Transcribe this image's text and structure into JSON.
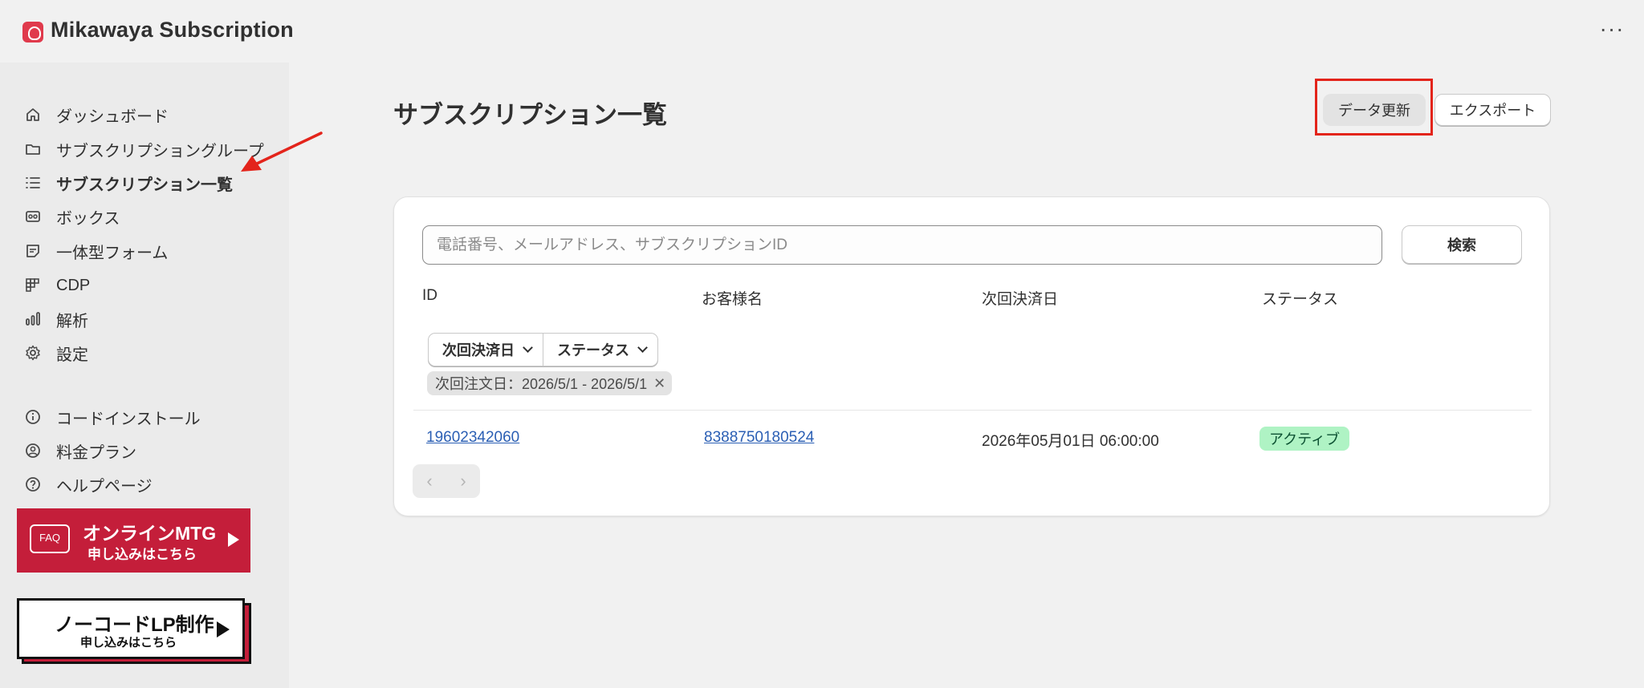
{
  "app": {
    "title": "Mikawaya Subscription",
    "more_label": "···"
  },
  "sidebar": {
    "items": [
      {
        "label": "ダッシュボード",
        "icon": "home-icon"
      },
      {
        "label": "サブスクリプショングループ",
        "icon": "folder-icon"
      },
      {
        "label": "サブスクリプション一覧",
        "icon": "list-icon",
        "active": true
      },
      {
        "label": "ボックス",
        "icon": "box-icon"
      },
      {
        "label": "一体型フォーム",
        "icon": "form-icon"
      },
      {
        "label": "CDP",
        "icon": "grid-icon"
      },
      {
        "label": "解析",
        "icon": "chart-icon"
      },
      {
        "label": "設定",
        "icon": "gear-icon"
      }
    ],
    "items2": [
      {
        "label": "コードインストール",
        "icon": "info-icon"
      },
      {
        "label": "料金プラン",
        "icon": "user-circle-icon"
      },
      {
        "label": "ヘルプページ",
        "icon": "help-icon"
      }
    ],
    "banner_mtg": {
      "faq": "FAQ",
      "title": "オンラインMTG",
      "sub": "申し込みはこちら"
    },
    "banner_lp": {
      "title": "ノーコードLP制作",
      "sub": "申し込みはこちら"
    }
  },
  "main": {
    "title": "サブスクリプション一覧",
    "refresh_label": "データ更新",
    "export_label": "エクスポート",
    "search": {
      "placeholder": "電話番号、メールアドレス、サブスクリプションID",
      "button": "検索"
    },
    "columns": [
      "ID",
      "お客様名",
      "次回決済日",
      "ステータス"
    ],
    "filters": [
      "次回決済日",
      "ステータス"
    ],
    "filter_tag": "次回注文日：2026/5/1 - 2026/5/1",
    "rows": [
      {
        "id": "19602342060",
        "customer": "8388750180524",
        "next_date": "2026年05月01日 06:00:00",
        "status": "アクティブ"
      }
    ]
  },
  "colors": {
    "accent_red": "#c41e3a",
    "highlight": "#e3241b",
    "status_active_bg": "#aff3c4",
    "link": "#2b5fb4"
  }
}
